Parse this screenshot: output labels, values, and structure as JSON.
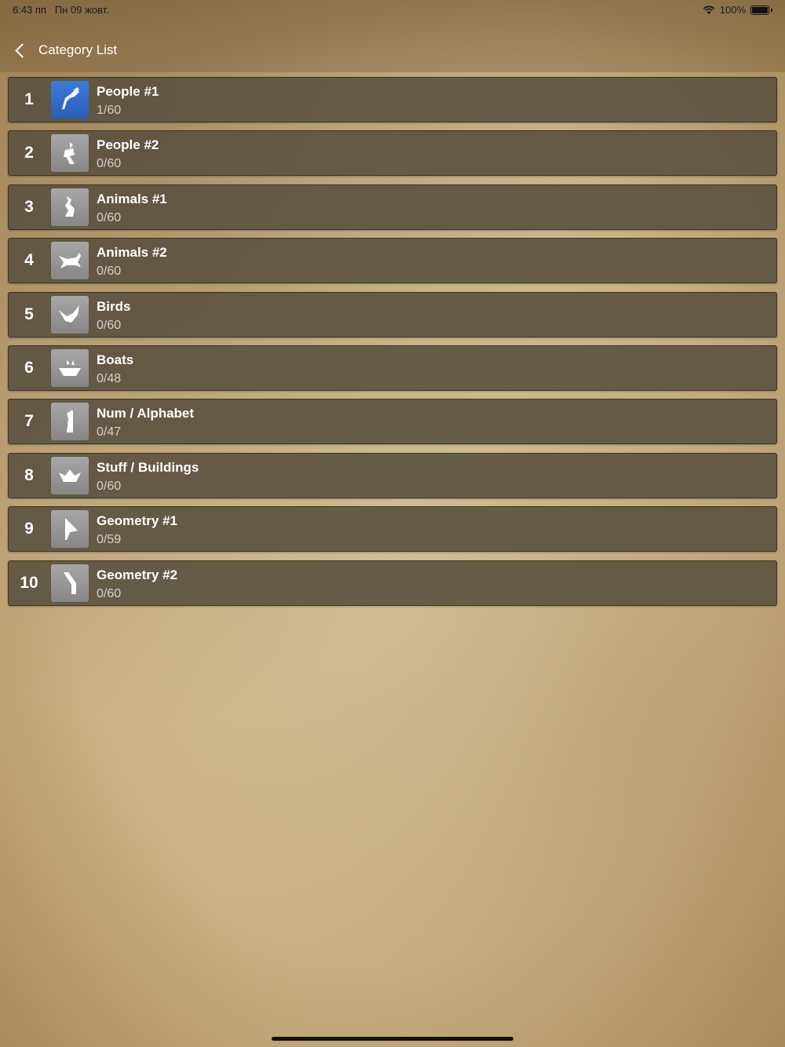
{
  "status": {
    "time": "6:43 пп",
    "date": "Пн 09 жовт.",
    "battery": "100%"
  },
  "nav": {
    "back_label": "Category List"
  },
  "categories": [
    {
      "num": "1",
      "title": "People #1",
      "progress": "1/60",
      "icon": "kicking-person-icon"
    },
    {
      "num": "2",
      "title": "People #2",
      "progress": "0/60",
      "icon": "running-person-icon"
    },
    {
      "num": "3",
      "title": "Animals #1",
      "progress": "0/60",
      "icon": "sitting-animal-icon"
    },
    {
      "num": "4",
      "title": "Animals #2",
      "progress": "0/60",
      "icon": "running-animal-icon"
    },
    {
      "num": "5",
      "title": "Birds",
      "progress": "0/60",
      "icon": "bird-icon"
    },
    {
      "num": "6",
      "title": "Boats",
      "progress": "0/48",
      "icon": "boat-icon"
    },
    {
      "num": "7",
      "title": "Num / Alphabet",
      "progress": "0/47",
      "icon": "number-one-icon"
    },
    {
      "num": "8",
      "title": "Stuff / Buildings",
      "progress": "0/60",
      "icon": "bowl-icon"
    },
    {
      "num": "9",
      "title": "Geometry #1",
      "progress": "0/59",
      "icon": "arrow-shape-icon"
    },
    {
      "num": "10",
      "title": "Geometry #2",
      "progress": "0/60",
      "icon": "slanted-shape-icon"
    }
  ],
  "colors": {
    "active_thumb": "#2f6cc9",
    "row_bg": "#58503e"
  }
}
